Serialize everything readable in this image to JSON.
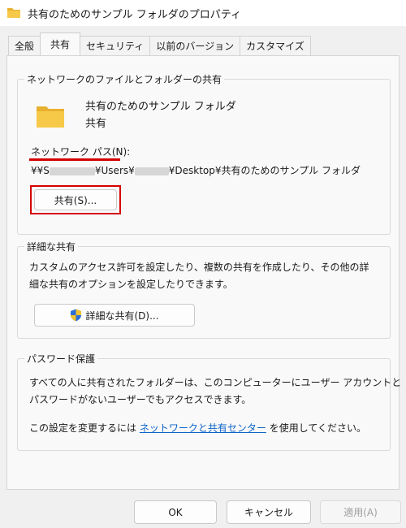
{
  "window": {
    "title": "共有のためのサンプル フォルダのプロパティ"
  },
  "tabs": [
    {
      "label": "全般"
    },
    {
      "label": "共有",
      "active": true
    },
    {
      "label": "セキュリティ"
    },
    {
      "label": "以前のバージョン"
    },
    {
      "label": "カスタマイズ"
    }
  ],
  "network_share": {
    "group_title": "ネットワークのファイルとフォルダーの共有",
    "folder_name": "共有のためのサンプル フォルダ",
    "status": "共有",
    "path_label": "ネットワーク パス(N):",
    "path_prefix": "¥¥S",
    "path_mid": "¥Users¥",
    "path_suffix": "¥Desktop¥共有のためのサンプル フォルダ",
    "share_button": "共有(S)..."
  },
  "advanced_share": {
    "group_title": "詳細な共有",
    "description_line1": "カスタムのアクセス許可を設定したり、複数の共有を作成したり、その他の詳",
    "description_line2": "細な共有のオプションを設定したりできます。",
    "button": "詳細な共有(D)..."
  },
  "password_protect": {
    "group_title": "パスワード保護",
    "description_line1": "すべての人に共有されたフォルダーは、このコンピューターにユーザー アカウントと",
    "description_line2": "パスワードがないユーザーでもアクセスできます。",
    "change_prefix": "この設定を変更するには",
    "link_text": "ネットワークと共有センター",
    "change_suffix": "を使用してください。"
  },
  "footer": {
    "ok": "OK",
    "cancel": "キャンセル",
    "apply": "適用(A)"
  },
  "colors": {
    "annotation_red": "#d40000",
    "link_blue": "#0b63c7",
    "folder_yellow": "#f7c948"
  }
}
